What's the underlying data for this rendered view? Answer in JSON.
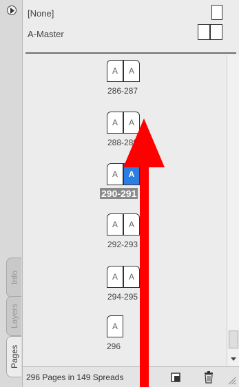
{
  "tabs": [
    {
      "label": "Info",
      "active": false
    },
    {
      "label": "Layers",
      "active": false
    },
    {
      "label": "Pages",
      "active": true
    }
  ],
  "masters": [
    {
      "label": "[None]",
      "icon": "single-page-icon"
    },
    {
      "label": "A-Master",
      "icon": "spread-icon"
    }
  ],
  "spreads": [
    {
      "label": "286-287",
      "pages": [
        "A",
        "A"
      ],
      "selected": false
    },
    {
      "label": "288-289",
      "pages": [
        "A",
        "A"
      ],
      "selected": false
    },
    {
      "label": "290-291",
      "pages": [
        "A",
        "A"
      ],
      "selected": true
    },
    {
      "label": "292-293",
      "pages": [
        "A",
        "A"
      ],
      "selected": false
    },
    {
      "label": "294-295",
      "pages": [
        "A",
        "A"
      ],
      "selected": false
    },
    {
      "label": "296",
      "pages": [
        "A"
      ],
      "selected": false
    }
  ],
  "status": {
    "text": "296 Pages in 149 Spreads"
  },
  "colors": {
    "selection": "#2c7fe0",
    "annotation_arrow": "#ff0000"
  }
}
